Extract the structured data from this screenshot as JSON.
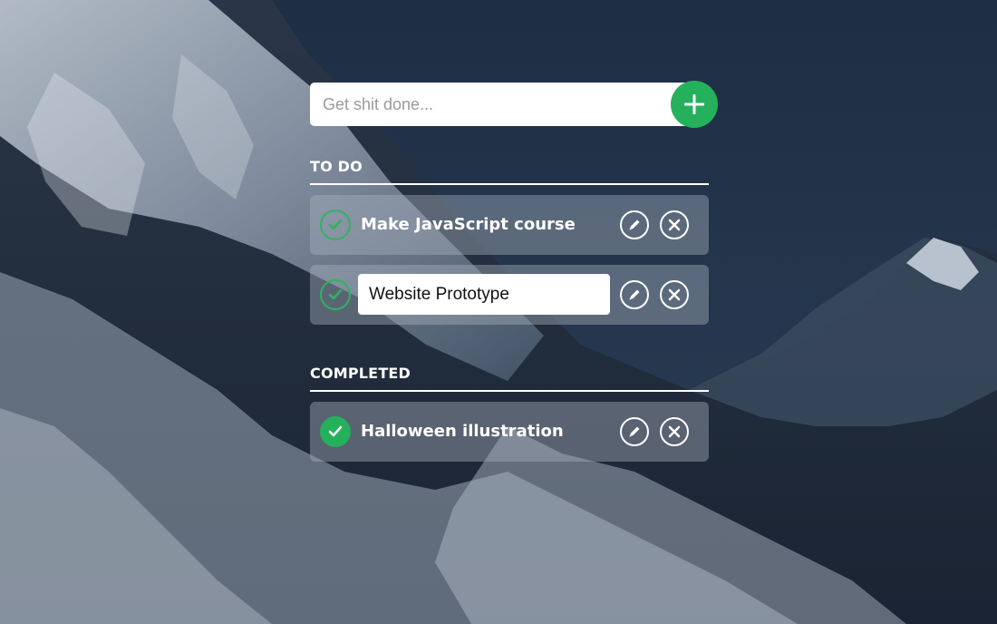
{
  "new_task": {
    "placeholder": "Get shit done...",
    "add_icon": "plus-icon"
  },
  "sections": {
    "todo": {
      "heading": "TO DO",
      "tasks": [
        {
          "label": "Make JavaScript course",
          "editing": false
        },
        {
          "label": "Website Prototype",
          "editing": true
        }
      ]
    },
    "completed": {
      "heading": "COMPLETED",
      "tasks": [
        {
          "label": "Halloween illustration",
          "editing": false
        }
      ]
    }
  },
  "icons": {
    "check": "check-icon",
    "edit": "pencil-icon",
    "delete": "close-icon"
  },
  "colors": {
    "accent_green": "#25b15c",
    "task_background": "rgba(170,178,190,0.42)",
    "text": "#ffffff"
  }
}
